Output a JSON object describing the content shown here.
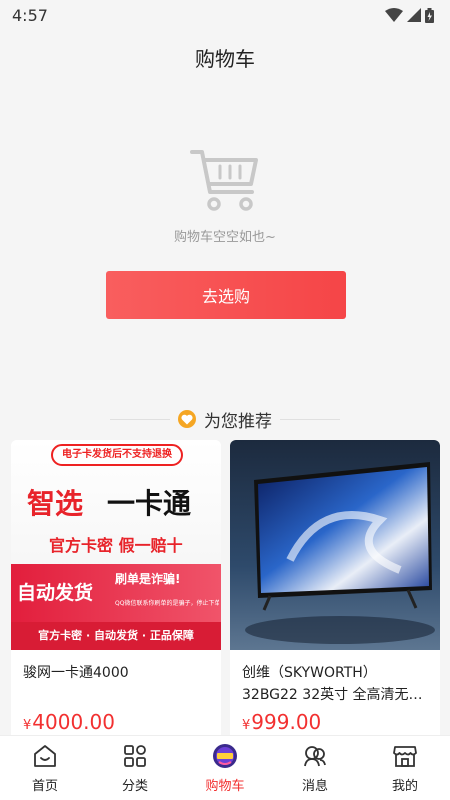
{
  "status_bar": {
    "time": "4:57"
  },
  "header": {
    "title": "购物车"
  },
  "empty_state": {
    "message": "购物车空空如也~",
    "button_label": "去选购"
  },
  "recommend": {
    "title": "为您推荐"
  },
  "products": [
    {
      "name": "骏网一卡通4000",
      "price_symbol": "¥",
      "price": "4000.00",
      "image_text": {
        "notice": "电子卡发货后不支持退换",
        "headline_a": "智选",
        "headline_b": "一卡通",
        "subline": "官方卡密 假一赔十",
        "auto": "自动发货",
        "fraud": "刷单是诈骗!",
        "fine": "QQ微信联系你刷单的是骗子，停止下单!",
        "footer": "官方卡密 · 自动发货 · 正品保障"
      }
    },
    {
      "name": "创维（SKYWORTH）32BG22 32英寸 全高清无…",
      "price_symbol": "¥",
      "price": "999.00"
    }
  ],
  "tab_bar": {
    "items": [
      {
        "label": "首页",
        "icon": "home-icon"
      },
      {
        "label": "分类",
        "icon": "category-icon"
      },
      {
        "label": "购物车",
        "icon": "cart-badge-icon",
        "active": true
      },
      {
        "label": "消息",
        "icon": "message-icon"
      },
      {
        "label": "我的",
        "icon": "store-icon"
      }
    ]
  },
  "colors": {
    "accent": "#f23030",
    "button": "#f54547",
    "heart": "#f5a623"
  }
}
